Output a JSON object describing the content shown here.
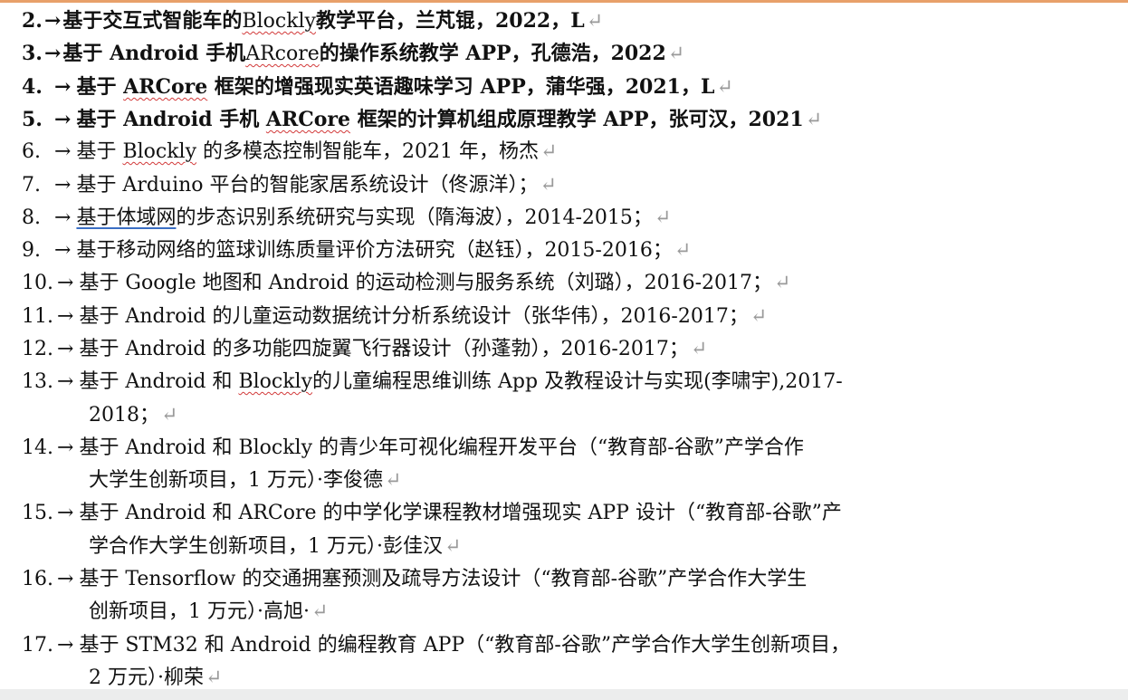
{
  "items": [
    {
      "num": "2.",
      "arrow": "→",
      "pre": "基于交互式智能车的",
      "mark": "Blockly",
      "post": "教学平台，兰芃锟，2022，L",
      "cont": ""
    },
    {
      "num": "3.",
      "arrow": "→",
      "pre": "基于 Android 手机",
      "mark": "ARcore",
      "post": "的操作系统教学 APP，孔德浩，2022",
      "cont": ""
    },
    {
      "num": "4.",
      "arrow": "→",
      "pre": "基于",
      "mark": "ARCore",
      "post": "框架的增强现实英语趣味学习 APP，蒲华强，2021，L",
      "cont": ""
    },
    {
      "num": "5.",
      "arrow": "→",
      "pre": "基于 Android 手机",
      "mark": "ARCore",
      "post": "框架的计算机组成原理教学 APP，张可汉，2021",
      "cont": ""
    },
    {
      "num": "6.",
      "arrow": "→",
      "pre": "基于",
      "mark": "Blockly",
      "post": "的多模态控制智能车，2021 年，杨杰",
      "cont": ""
    },
    {
      "num": "7.",
      "arrow": "→",
      "pre": "基于 Arduino 平台的智能家居系统设计（佟源洋）；",
      "mark": "",
      "post": "",
      "cont": ""
    },
    {
      "num": "8.",
      "arrow": "→",
      "pre": "",
      "mark": "基于体域网",
      "post": "的步态识别系统研究与实现（隋海波），2014-2015；",
      "cont": ""
    },
    {
      "num": "9.",
      "arrow": "→",
      "pre": "基于移动网络的篮球训练质量评价方法研究（赵钰），2015-2016；",
      "mark": "",
      "post": "",
      "cont": ""
    },
    {
      "num": "10.",
      "arrow": "→",
      "pre": "基于 Google 地图和 Android 的运动检测与服务系统（刘璐），2016-2017；",
      "mark": "",
      "post": "",
      "cont": ""
    },
    {
      "num": "11.",
      "arrow": "→",
      "pre": "基于 Android 的儿童运动数据统计分析系统设计（张华伟），2016-2017；",
      "mark": "",
      "post": "",
      "cont": ""
    },
    {
      "num": "12.",
      "arrow": "→",
      "pre": "基于 Android 的多功能四旋翼飞行器设计（孙蓬勃），2016-2017；",
      "mark": "",
      "post": "",
      "cont": ""
    },
    {
      "num": "13.",
      "arrow": "→",
      "pre": "基于 Android 和",
      "mark": "Blockly",
      "post": "的儿童编程思维训练 App 及教程设计与实现(李啸宇),2017-",
      "cont": "2018；"
    },
    {
      "num": "14.",
      "arrow": "→",
      "pre": "基于 Android 和 Blockly 的青少年可视化编程开发平台（“教育部-谷歌”产学合作",
      "mark": "",
      "post": "",
      "cont": "大学生创新项目，1 万元）·李俊德"
    },
    {
      "num": "15.",
      "arrow": "→",
      "pre": "基于 Android 和 ARCore 的中学化学课程教材增强现实 APP 设计（“教育部-谷歌”产",
      "mark": "",
      "post": "",
      "cont": "学合作大学生创新项目，1 万元）·彭佳汉"
    },
    {
      "num": "16.",
      "arrow": "→",
      "pre": "基于 Tensorflow 的交通拥塞预测及疏导方法设计（“教育部-谷歌”产学合作大学生",
      "mark": "",
      "post": "",
      "cont": "创新项目，1 万元）·高旭·"
    },
    {
      "num": "17.",
      "arrow": "→",
      "pre": "基于 STM32 和 Android 的编程教育 APP（“教育部-谷歌”产学合作大学生创新项目，",
      "mark": "",
      "post": "",
      "cont": "2 万元）·柳荣"
    }
  ],
  "paragraph_mark": "↵"
}
